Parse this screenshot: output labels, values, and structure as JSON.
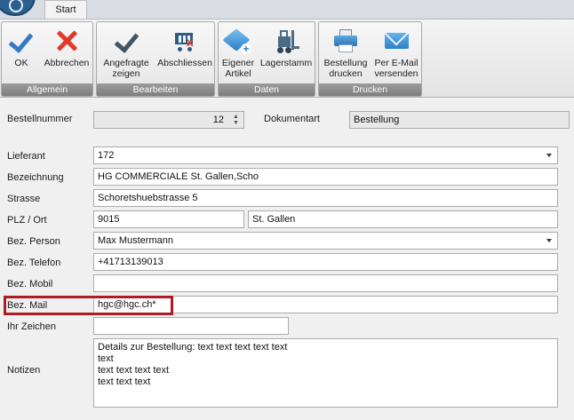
{
  "tabs": {
    "start": "Start"
  },
  "ribbon": {
    "groups": {
      "allgemein": {
        "label": "Allgemein",
        "ok": "OK",
        "abbrechen": "Abbrechen"
      },
      "bearbeiten": {
        "label": "Bearbeiten",
        "angefragte_zeigen_l1": "Angefragte",
        "angefragte_zeigen_l2": "zeigen",
        "abschliessen": "Abschliessen"
      },
      "daten": {
        "label": "Daten",
        "eigener_artikel_l1": "Eigener",
        "eigener_artikel_l2": "Artikel",
        "lagerstamm": "Lagerstamm"
      },
      "drucken": {
        "label": "Drucken",
        "bestellung_drucken_l1": "Bestellung",
        "bestellung_drucken_l2": "drucken",
        "email_versenden_l1": "Per E-Mail",
        "email_versenden_l2": "versenden"
      }
    }
  },
  "form": {
    "bestellnummer": {
      "label": "Bestellnummer",
      "value": "12"
    },
    "dokumentart": {
      "label": "Dokumentart",
      "value": "Bestellung"
    },
    "lieferant": {
      "label": "Lieferant",
      "value": "172"
    },
    "bezeichnung": {
      "label": "Bezeichnung",
      "value": "HG COMMERCIALE St. Gallen,Scho"
    },
    "strasse": {
      "label": "Strasse",
      "value": "Schoretshuebstrasse 5"
    },
    "plz_ort": {
      "label": "PLZ / Ort",
      "plz": "9015",
      "ort": "St. Gallen"
    },
    "bez_person": {
      "label": "Bez. Person",
      "value": "Max Mustermann"
    },
    "bez_telefon": {
      "label": "Bez. Telefon",
      "value": "+41713139013"
    },
    "bez_mobil": {
      "label": "Bez. Mobil",
      "value": ""
    },
    "bez_mail": {
      "label": "Bez. Mail",
      "value": "hgc@hgc.ch*"
    },
    "ihr_zeichen": {
      "label": "Ihr Zeichen",
      "value": ""
    },
    "notizen": {
      "label": "Notizen",
      "value": "Details zur Bestellung: text text text text text\ntext\ntext text text text\ntext text text"
    }
  },
  "colors": {
    "highlight": "#b01c24",
    "accent": "#3478c8"
  }
}
